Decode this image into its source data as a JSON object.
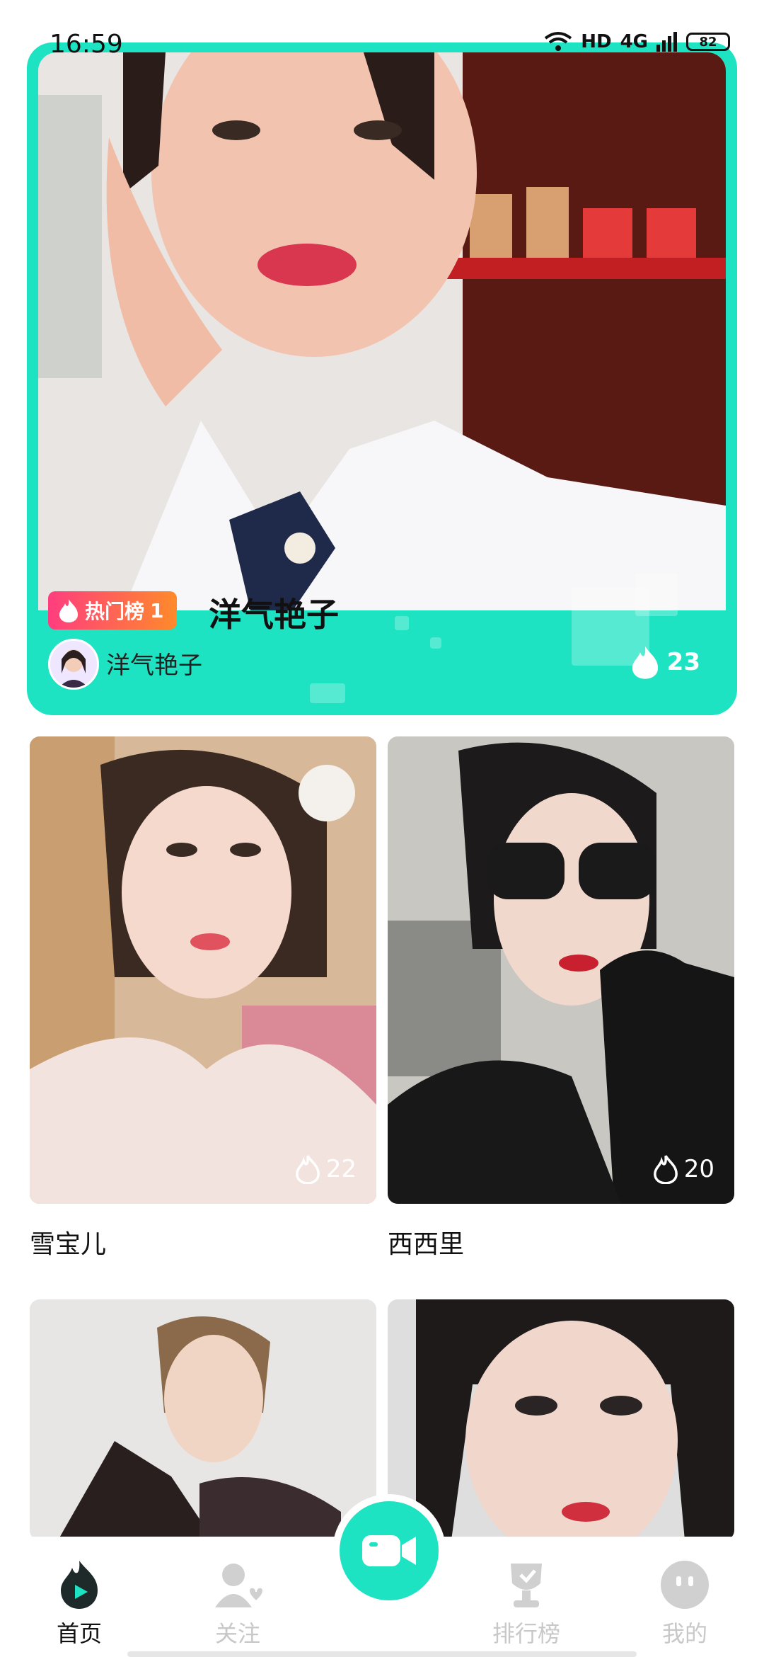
{
  "status": {
    "time": "16:59",
    "network": "HD",
    "signal": "4G",
    "battery": "82"
  },
  "hero": {
    "badge_label": "热门榜",
    "badge_rank": "1",
    "title": "洋气艳子",
    "username": "洋气艳子",
    "hot_count": "23",
    "accent_color": "#1ee3c3"
  },
  "grid": {
    "cards": [
      {
        "name": "雪宝儿",
        "hot_count": "22"
      },
      {
        "name": "西西里",
        "hot_count": "20"
      },
      {
        "name": "",
        "hot_count": ""
      },
      {
        "name": "",
        "hot_count": ""
      }
    ]
  },
  "nav": {
    "items": [
      {
        "label": "首页",
        "icon": "flame-play-icon"
      },
      {
        "label": "关注",
        "icon": "user-heart-icon"
      },
      {
        "label": "排行榜",
        "icon": "trophy-icon"
      },
      {
        "label": "我的",
        "icon": "face-icon"
      }
    ],
    "center_icon": "video-camera-icon"
  }
}
